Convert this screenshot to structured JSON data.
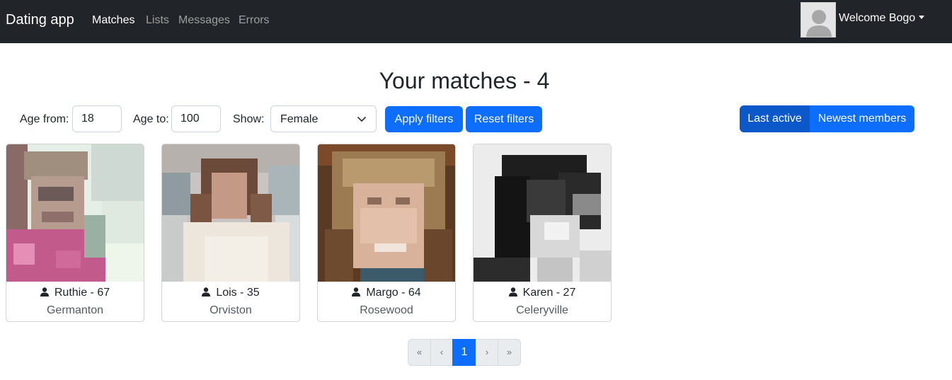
{
  "navbar": {
    "brand": "Dating app",
    "links": [
      {
        "label": "Matches",
        "active": true
      },
      {
        "label": "Lists",
        "active": false
      },
      {
        "label": "Messages",
        "active": false
      },
      {
        "label": "Errors",
        "active": false
      }
    ],
    "user_menu": {
      "welcome": "Welcome Bogo",
      "avatar_icon": "user-silhouette-icon"
    }
  },
  "page": {
    "title": "Your matches - 4"
  },
  "filters": {
    "age_from_label": "Age from:",
    "age_from_value": "18",
    "age_to_label": "Age to:",
    "age_to_value": "100",
    "show_label": "Show:",
    "show_value": "Female",
    "apply_label": "Apply filters",
    "reset_label": "Reset filters"
  },
  "sort": {
    "options": [
      "Last active",
      "Newest members"
    ],
    "selected": "Last active"
  },
  "members": [
    {
      "name_age": "Ruthie - 67",
      "city": "Germanton"
    },
    {
      "name_age": "Lois - 35",
      "city": "Orviston"
    },
    {
      "name_age": "Margo - 64",
      "city": "Rosewood"
    },
    {
      "name_age": "Karen - 27",
      "city": "Celeryville"
    }
  ],
  "pagination": {
    "first": "«",
    "prev": "‹",
    "current": "1",
    "next": "›",
    "last": "»"
  },
  "colors": {
    "navbar_bg": "#212529",
    "primary": "#0d6efd",
    "primary_active": "#0a58ca"
  }
}
